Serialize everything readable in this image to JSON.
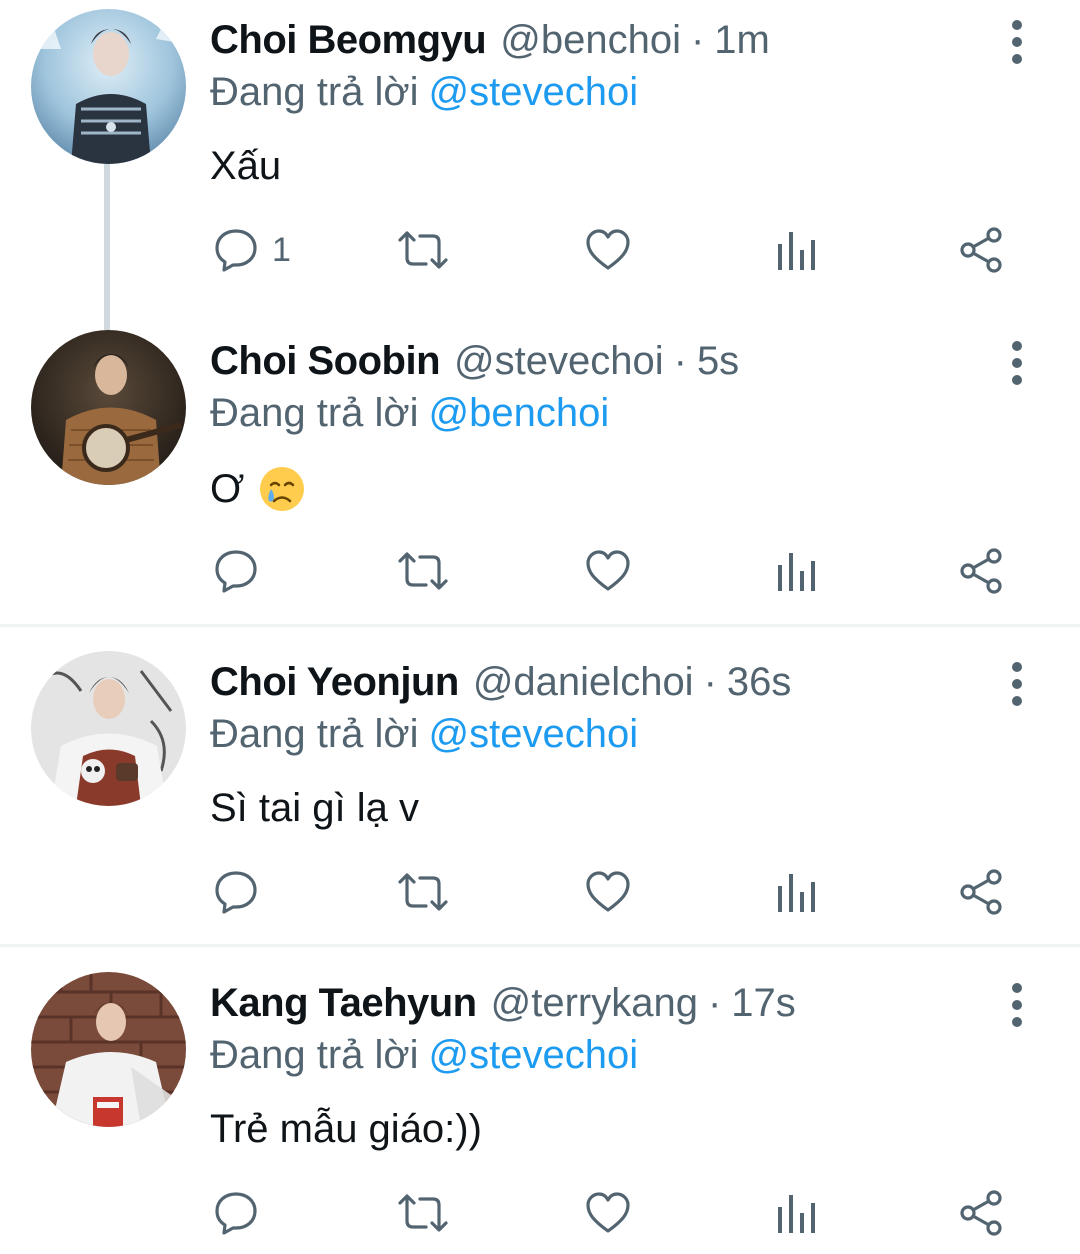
{
  "reply_prefix": "Đang trả lời",
  "colors": {
    "accent": "#1d9bf0",
    "muted": "#536471",
    "text": "#0f1419",
    "divider": "#eff3f4"
  },
  "icons": {
    "reply": "speech-bubble-icon",
    "retweet": "retweet-icon",
    "like": "heart-icon",
    "views": "bar-chart-icon",
    "share": "share-icon",
    "more": "vertical-dots-icon"
  },
  "tweets": [
    {
      "name": "Choi Beomgyu",
      "handle": "@benchoi",
      "time": "1m",
      "reply_to": "@stevechoi",
      "text": "Xấu",
      "reply_count": "1"
    },
    {
      "name": "Choi Soobin",
      "handle": "@stevechoi",
      "time": "5s",
      "reply_to": "@benchoi",
      "text": "Ơ",
      "emoji": "crying-face-emoji",
      "reply_count": ""
    },
    {
      "name": "Choi Yeonjun",
      "handle": "@danielchoi",
      "time": "36s",
      "reply_to": "@stevechoi",
      "text": "Sì tai gì lạ v",
      "reply_count": ""
    },
    {
      "name": "Kang Taehyun",
      "handle": "@terrykang",
      "time": "17s",
      "reply_to": "@stevechoi",
      "text": "Trẻ mẫu giáo:))",
      "reply_count": ""
    }
  ]
}
